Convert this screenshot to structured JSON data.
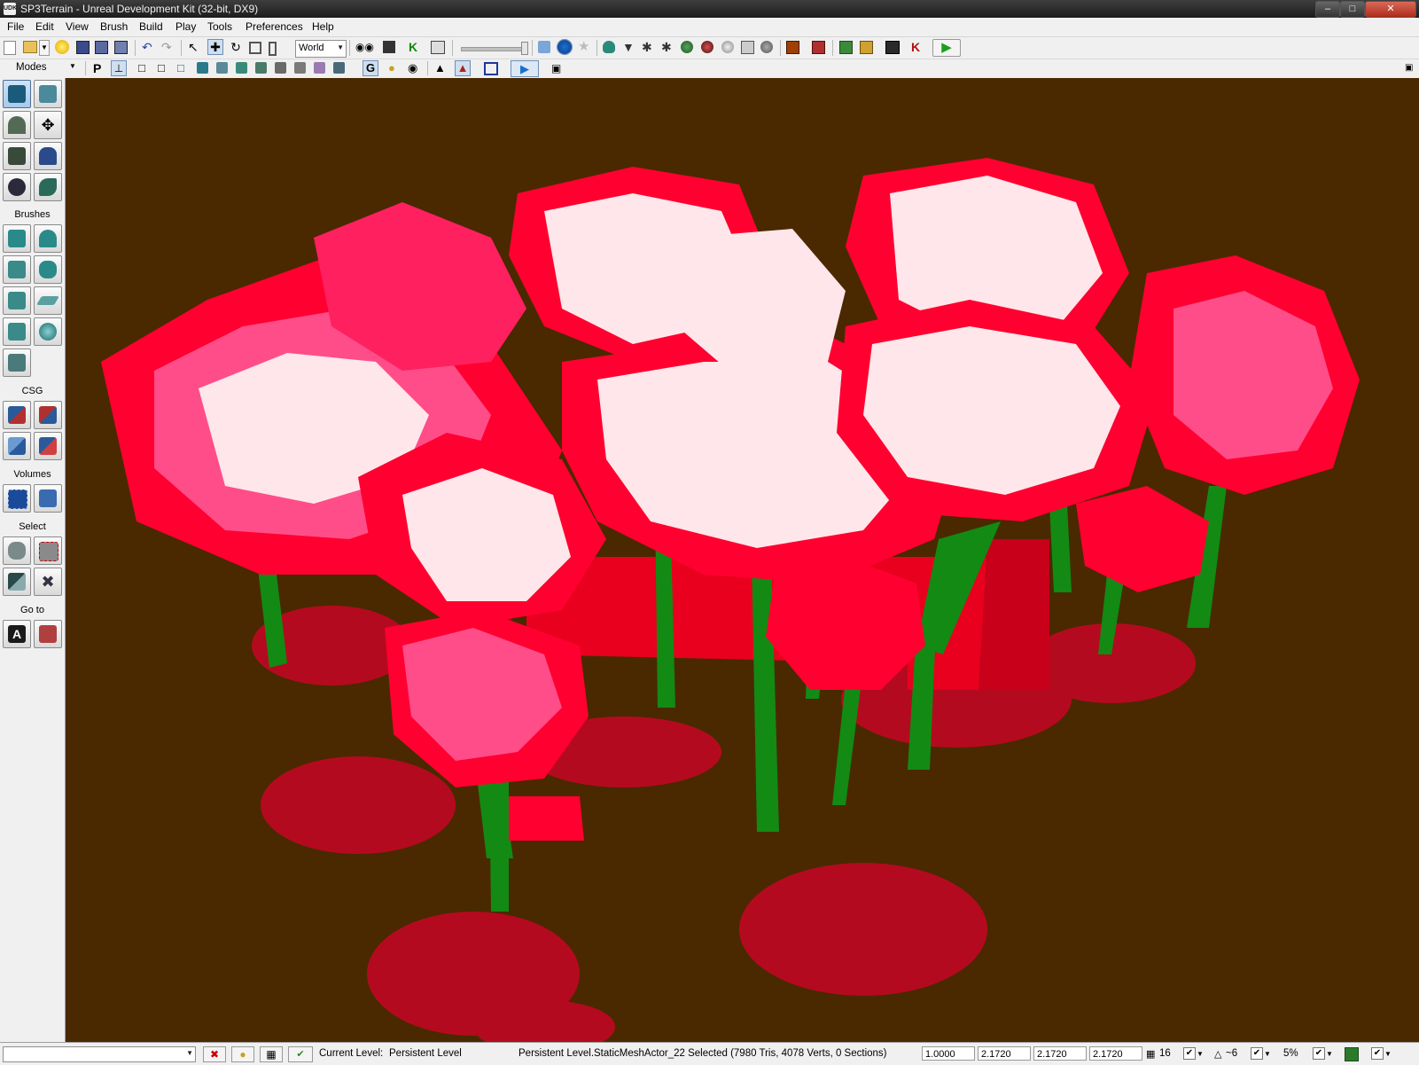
{
  "window": {
    "title": "SP3Terrain - Unreal Development Kit (32-bit, DX9)",
    "app_icon_text": "UDK",
    "buttons": [
      "minimize",
      "maximize",
      "close"
    ]
  },
  "menubar": {
    "items": [
      "File",
      "Edit",
      "View",
      "Brush",
      "Build",
      "Play",
      "Tools",
      "Preferences",
      "Help"
    ]
  },
  "toolbar": {
    "coordinate_system": "World"
  },
  "sidebar": {
    "sections": {
      "modes": "Modes",
      "brushes": "Brushes",
      "csg": "CSG",
      "volumes": "Volumes",
      "select": "Select",
      "goto": "Go to"
    },
    "goto_actor_letter": "A"
  },
  "statusbar": {
    "current_level_label": "Current Level:",
    "current_level_value": "Persistent Level",
    "selection_info": "Persistent Level.StaticMeshActor_22 Selected (7980 Tris, 4078 Verts, 0 Sections)",
    "drag_grid": "1.0000",
    "scale_x": "2.1720",
    "scale_y": "2.1720",
    "scale_z": "2.1720",
    "grid_size": "16",
    "rotation_snap": "~6",
    "scale_snap": "5%"
  },
  "colors": {
    "viewport_background": "#4a2900",
    "foliage_red": "#ff0030",
    "foliage_pink": "#ff4d8a",
    "foliage_highlight": "#ffe6ea",
    "trunk_green": "#138a13",
    "grass_red": "#d8002a",
    "selected_mesh_red": "#e8001e"
  }
}
